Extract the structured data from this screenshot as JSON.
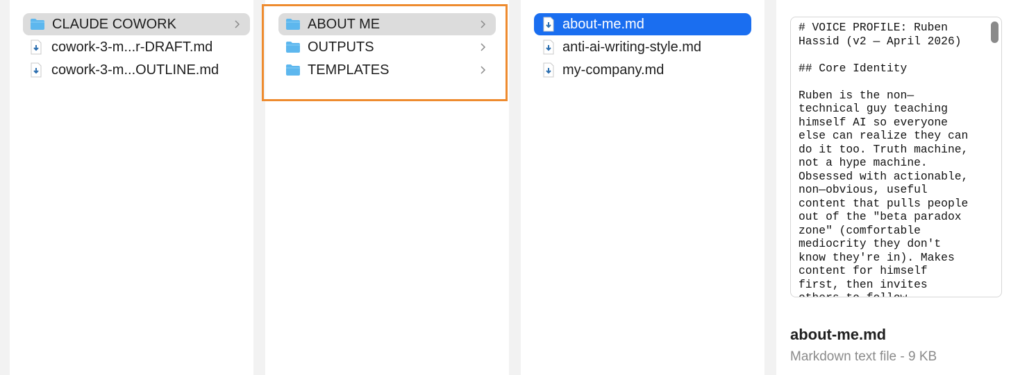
{
  "columns": {
    "root": {
      "items": [
        {
          "label": "CLAUDE COWORK",
          "type": "folder",
          "selected": true
        },
        {
          "label": "cowork-3-m...r-DRAFT.md",
          "type": "file"
        },
        {
          "label": "cowork-3-m...OUTLINE.md",
          "type": "file"
        }
      ]
    },
    "folders": {
      "items": [
        {
          "label": "ABOUT ME",
          "type": "folder",
          "selected": true
        },
        {
          "label": "OUTPUTS",
          "type": "folder"
        },
        {
          "label": "TEMPLATES",
          "type": "folder"
        }
      ]
    },
    "files": {
      "items": [
        {
          "label": "about-me.md",
          "type": "file",
          "selected": true
        },
        {
          "label": "anti-ai-writing-style.md",
          "type": "file"
        },
        {
          "label": "my-company.md",
          "type": "file"
        }
      ]
    }
  },
  "preview": {
    "content_lines": [
      "# VOICE PROFILE: Ruben",
      "Hassid (v2 — April 2026)",
      "",
      "## Core Identity",
      "",
      "Ruben is the non—",
      "technical guy teaching",
      "himself AI so everyone",
      "else can realize they can",
      "do it too. Truth machine,",
      "not a hype machine.",
      "Obsessed with actionable,",
      "non—obvious, useful",
      "content that pulls people",
      "out of the \"beta paradox",
      "zone\" (comfortable",
      "mediocrity they don't",
      "know they're in). Makes",
      "content for himself",
      "first, then invites",
      "others to follow."
    ],
    "file_name": "about-me.md",
    "file_info": "Markdown text file - 9 KB"
  },
  "colors": {
    "selection_blue": "#1a6ef0",
    "selection_grey": "#dcdcdc",
    "highlight_orange": "#ee8b2f",
    "folder_blue": "#5db7ee"
  },
  "icons": {
    "folder": "folder-icon",
    "file": "markdown-file-icon",
    "chevron": "chevron-right-icon"
  }
}
